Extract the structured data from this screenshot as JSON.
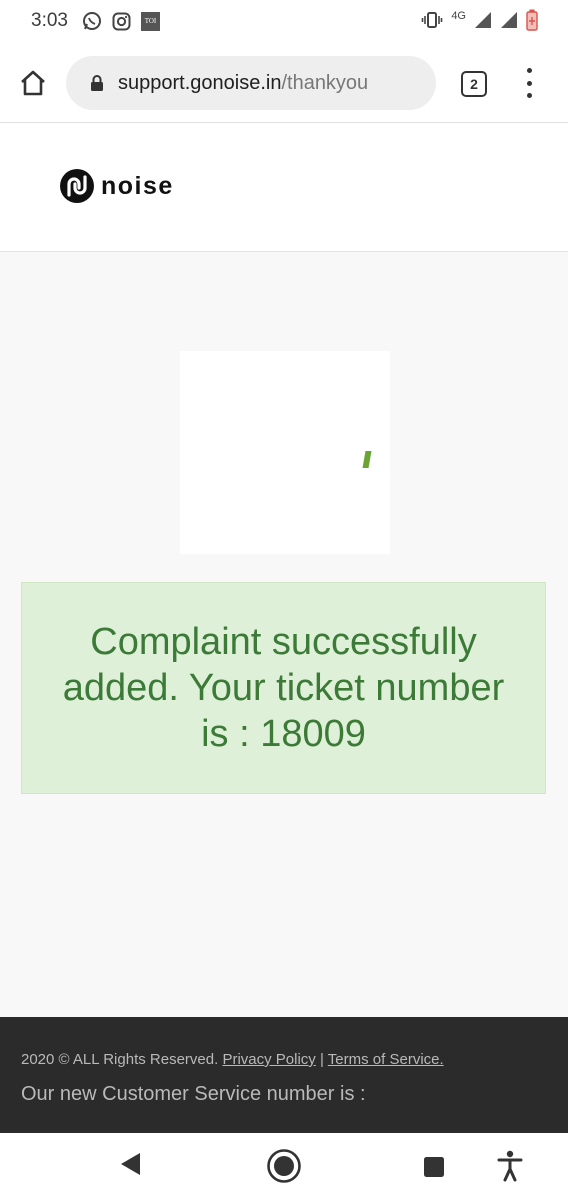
{
  "status_bar": {
    "time": "3:03",
    "left_icons": [
      "whatsapp-icon",
      "instagram-icon",
      "toi-icon"
    ],
    "toi_label": "TOI",
    "network_label": "4G",
    "right_icons": [
      "vibrate-icon",
      "signal-icon",
      "signal-icon",
      "battery-icon"
    ]
  },
  "browser": {
    "url_domain": "support.gonoise.in",
    "url_path": "/thankyou",
    "tab_count": "2"
  },
  "header": {
    "logo_text": "noise"
  },
  "main": {
    "message": "Complaint successfully added. Your ticket number is : 18009"
  },
  "footer": {
    "copyright": "2020 © ALL Rights Reserved.",
    "privacy_link": "Privacy Policy",
    "separator": "|",
    "terms_link": "Terms of Service.",
    "service_text": "Our new Customer Service number is :"
  },
  "colors": {
    "alert_bg": "#dff0d8",
    "alert_text": "#3c7a37",
    "footer_bg": "#2b2b2b"
  },
  "nav_bar": {
    "icons": [
      "back-icon",
      "home-circle-icon",
      "recents-icon",
      "accessibility-icon"
    ]
  }
}
